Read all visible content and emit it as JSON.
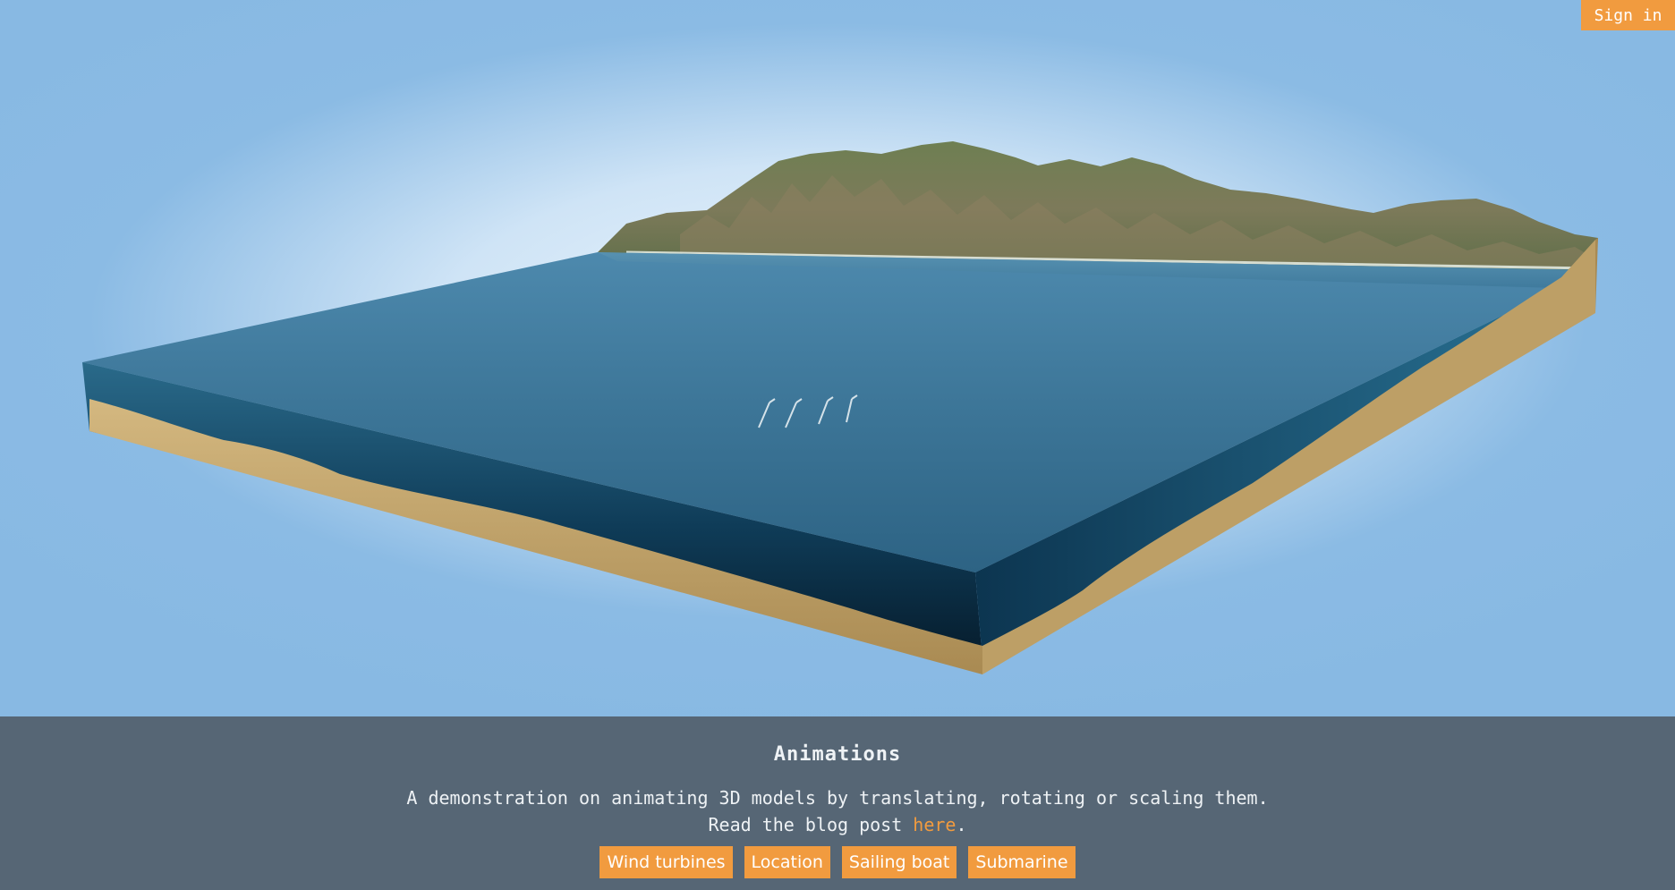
{
  "header": {
    "sign_in_label": "Sign in"
  },
  "panel": {
    "title": "Animations",
    "description": "A demonstration on animating 3D models by translating, rotating or scaling them.",
    "read_prefix": "Read the blog post ",
    "link_label": "here",
    "read_suffix": ".",
    "buttons": [
      {
        "label": "Wind turbines"
      },
      {
        "label": "Location"
      },
      {
        "label": "Sailing boat"
      },
      {
        "label": "Submarine"
      }
    ]
  },
  "colors": {
    "accent": "#f19b3f",
    "panel_bg": "#566675",
    "sky": "#8bbbe4",
    "water": "#3a7395",
    "sand": "#c9ad76"
  }
}
